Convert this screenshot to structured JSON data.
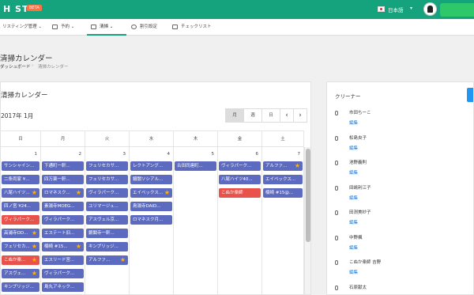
{
  "header": {
    "logo": "H ST",
    "badge": "BETA",
    "language": "日本語",
    "brand_color": "#14a37c"
  },
  "nav": [
    {
      "label": "リスティング管理",
      "caret": "⌄",
      "icon": "list-icon"
    },
    {
      "label": "予約",
      "caret": "⌄",
      "icon": "calendar-icon"
    },
    {
      "label": "清掃",
      "caret": "⌄",
      "icon": "cleaning-icon",
      "active": true
    },
    {
      "label": "割引設定",
      "caret": "",
      "icon": "gear-icon"
    },
    {
      "label": "チェックリスト",
      "caret": "",
      "icon": "checklist-icon"
    }
  ],
  "page": {
    "title": "清掃カレンダー",
    "breadcrumb_home": "ダッシュボード",
    "breadcrumb_sep": "›",
    "breadcrumb_current": "清掃カレンダー"
  },
  "calendar": {
    "card_title": "清掃カレンダー",
    "month": "2017年 1月",
    "view_buttons": [
      "月",
      "週",
      "日"
    ],
    "prev": "‹",
    "next": "›",
    "weekdays": [
      "日",
      "月",
      "火",
      "水",
      "木",
      "金",
      "土"
    ],
    "days": [
      {
        "date": "1",
        "events": [
          {
            "text": "サンシャイン...",
            "star": false,
            "red": false
          },
          {
            "text": "二条両家 ¥...",
            "star": false,
            "red": false
          },
          {
            "text": "八尾ハイツ...",
            "star": true,
            "red": false
          },
          {
            "text": "四ノ宮 ¥24...",
            "star": false,
            "red": false
          },
          {
            "text": "ヴィラパーク...",
            "star": false,
            "red": true
          },
          {
            "text": "高浦寺OD...",
            "star": true,
            "red": false
          },
          {
            "text": "フェリセカ...",
            "star": true,
            "red": false
          },
          {
            "text": "こぬか楽...",
            "star": true,
            "red": true
          },
          {
            "text": "アスヴェ...",
            "star": true,
            "red": false
          },
          {
            "text": "キンプリッジ...",
            "star": false,
            "red": false
          }
        ]
      },
      {
        "date": "2",
        "events": [
          {
            "text": "下通町一軒...",
            "star": false,
            "red": false
          },
          {
            "text": "四万薬一軒...",
            "star": false,
            "red": false
          },
          {
            "text": "ロマネスク...",
            "star": true,
            "red": false
          },
          {
            "text": "素湯寺MOEG...",
            "star": false,
            "red": false
          },
          {
            "text": "ヴィラパーク...",
            "star": false,
            "red": false
          },
          {
            "text": "エステート旧...",
            "star": false,
            "red": false
          },
          {
            "text": "楠崎 #15...",
            "star": true,
            "red": false
          },
          {
            "text": "エスリード宮...",
            "star": false,
            "red": false
          },
          {
            "text": "ヴィラパーク...",
            "star": false,
            "red": false
          },
          {
            "text": "島丸アネック...",
            "star": false,
            "red": false
          }
        ]
      },
      {
        "date": "3",
        "events": [
          {
            "text": "フェリセカサ...",
            "star": false,
            "red": false
          },
          {
            "text": "フェリセカサ...",
            "star": false,
            "red": false
          },
          {
            "text": "ヴィラパーク...",
            "star": false,
            "red": false
          },
          {
            "text": "ユリマージュ...",
            "star": false,
            "red": false
          },
          {
            "text": "アスヴェル京...",
            "star": false,
            "red": false
          },
          {
            "text": "銀閣寺一軒...",
            "star": false,
            "red": false
          },
          {
            "text": "キンプリッジ...",
            "star": false,
            "red": false
          },
          {
            "text": "アルファ...",
            "star": true,
            "red": false
          }
        ]
      },
      {
        "date": "4",
        "events": [
          {
            "text": "レクトアング...",
            "star": false,
            "red": false
          },
          {
            "text": "鐵闇ソシアル...",
            "star": false,
            "red": false
          },
          {
            "text": "エイベックス...",
            "star": true,
            "red": false
          },
          {
            "text": "鳥湯寺DAID...",
            "star": false,
            "red": false
          },
          {
            "text": "ロマネスク月...",
            "star": false,
            "red": false
          }
        ]
      },
      {
        "date": "5",
        "events": [
          {
            "text": "古田同連町...",
            "star": false,
            "red": false
          }
        ]
      },
      {
        "date": "6",
        "events": [
          {
            "text": "ヴィラパーク...",
            "star": false,
            "red": false
          },
          {
            "text": "八尾ハイツ40...",
            "star": false,
            "red": false
          },
          {
            "text": "こぬか楽師",
            "star": false,
            "red": true
          }
        ]
      },
      {
        "date": "7",
        "events": [
          {
            "text": "アルファ...",
            "star": true,
            "red": false
          },
          {
            "text": "エイベックス...",
            "star": false,
            "red": false
          },
          {
            "text": "楠崎 #15@...",
            "star": false,
            "red": false
          }
        ]
      }
    ]
  },
  "cleaners": {
    "title": "クリーナー",
    "edit_label": "編集",
    "items": [
      {
        "name": "市田ちーこ"
      },
      {
        "name": "松島央子"
      },
      {
        "name": "池野義則"
      },
      {
        "name": "田嶋利江子"
      },
      {
        "name": "田渕美紗子"
      },
      {
        "name": "中野楓"
      },
      {
        "name": "こぬか楽師 吉野"
      },
      {
        "name": "石原献太"
      }
    ]
  }
}
